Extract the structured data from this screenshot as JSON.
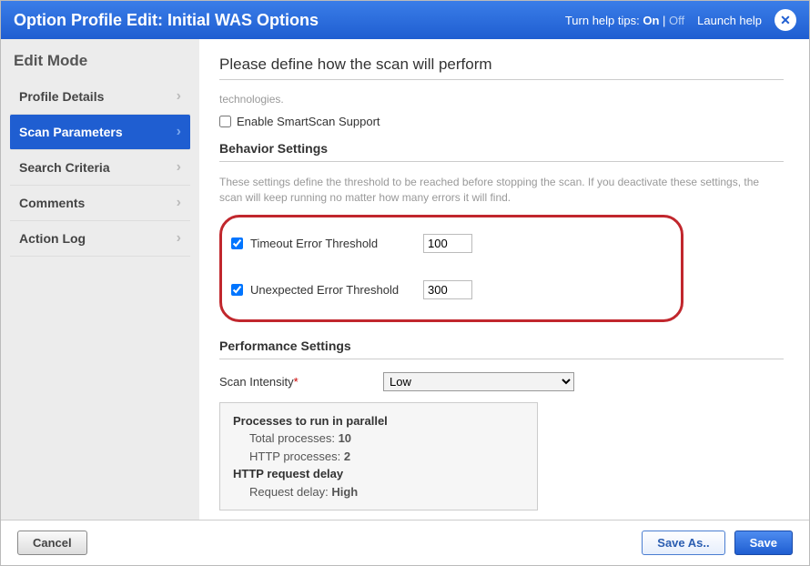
{
  "titlebar": {
    "title": "Option Profile Edit: Initial WAS Options",
    "help_tips_label": "Turn help tips:",
    "help_on": "On",
    "help_off": "Off",
    "launch_help": "Launch help"
  },
  "sidebar": {
    "title": "Edit Mode",
    "items": [
      {
        "label": "Profile Details"
      },
      {
        "label": "Scan Parameters"
      },
      {
        "label": "Search Criteria"
      },
      {
        "label": "Comments"
      },
      {
        "label": "Action Log"
      }
    ]
  },
  "main": {
    "heading": "Please define how the scan will perform",
    "top_text": "technologies.",
    "smartscan_label": "Enable SmartScan Support",
    "behavior": {
      "head": "Behavior Settings",
      "desc": "These settings define the threshold to be reached before stopping the scan. If you deactivate these settings, the scan will keep running no matter how many errors it will find.",
      "timeout_label": "Timeout Error Threshold",
      "timeout_value": "100",
      "unexpected_label": "Unexpected Error Threshold",
      "unexpected_value": "300"
    },
    "performance": {
      "head": "Performance Settings",
      "intensity_label": "Scan Intensity",
      "intensity_value": "Low",
      "info": {
        "processes_head": "Processes to run in parallel",
        "total_label": "Total processes:",
        "total_value": "10",
        "http_proc_label": "HTTP processes:",
        "http_proc_value": "2",
        "delay_head": "HTTP request delay",
        "delay_label": "Request delay:",
        "delay_value": "High"
      }
    }
  },
  "footer": {
    "cancel": "Cancel",
    "saveas": "Save As..",
    "save": "Save"
  }
}
